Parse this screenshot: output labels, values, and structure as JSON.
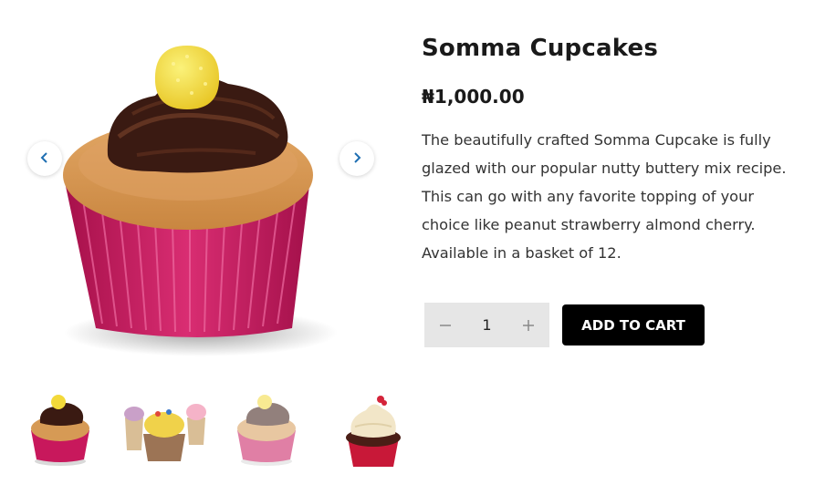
{
  "product": {
    "title": "Somma Cupcakes",
    "price": "₦1,000.00",
    "description": "The beautifully crafted Somma Cupcake is fully glazed with our popular nutty buttery mix recipe. This can go with any favorite topping of your choice like peanut strawberry almond cherry. Available in a basket of 12."
  },
  "gallery": {
    "prev_icon": "chevron-left-icon",
    "next_icon": "chevron-right-icon",
    "thumbnails": [
      "cupcake-candy-topping",
      "assorted-cupcakes",
      "cupcake-candy-topping-alt",
      "cupcake-cream-swirl"
    ]
  },
  "cart": {
    "quantity": "1",
    "minus_icon": "minus-icon",
    "plus_icon": "plus-icon",
    "add_label": "ADD TO CART"
  },
  "colors": {
    "button_bg": "#000000",
    "qty_bg": "#e6e6e6",
    "wrapper_pink": "#c8185c",
    "chocolate": "#3a1a12",
    "candy_yellow": "#f3d93a"
  }
}
